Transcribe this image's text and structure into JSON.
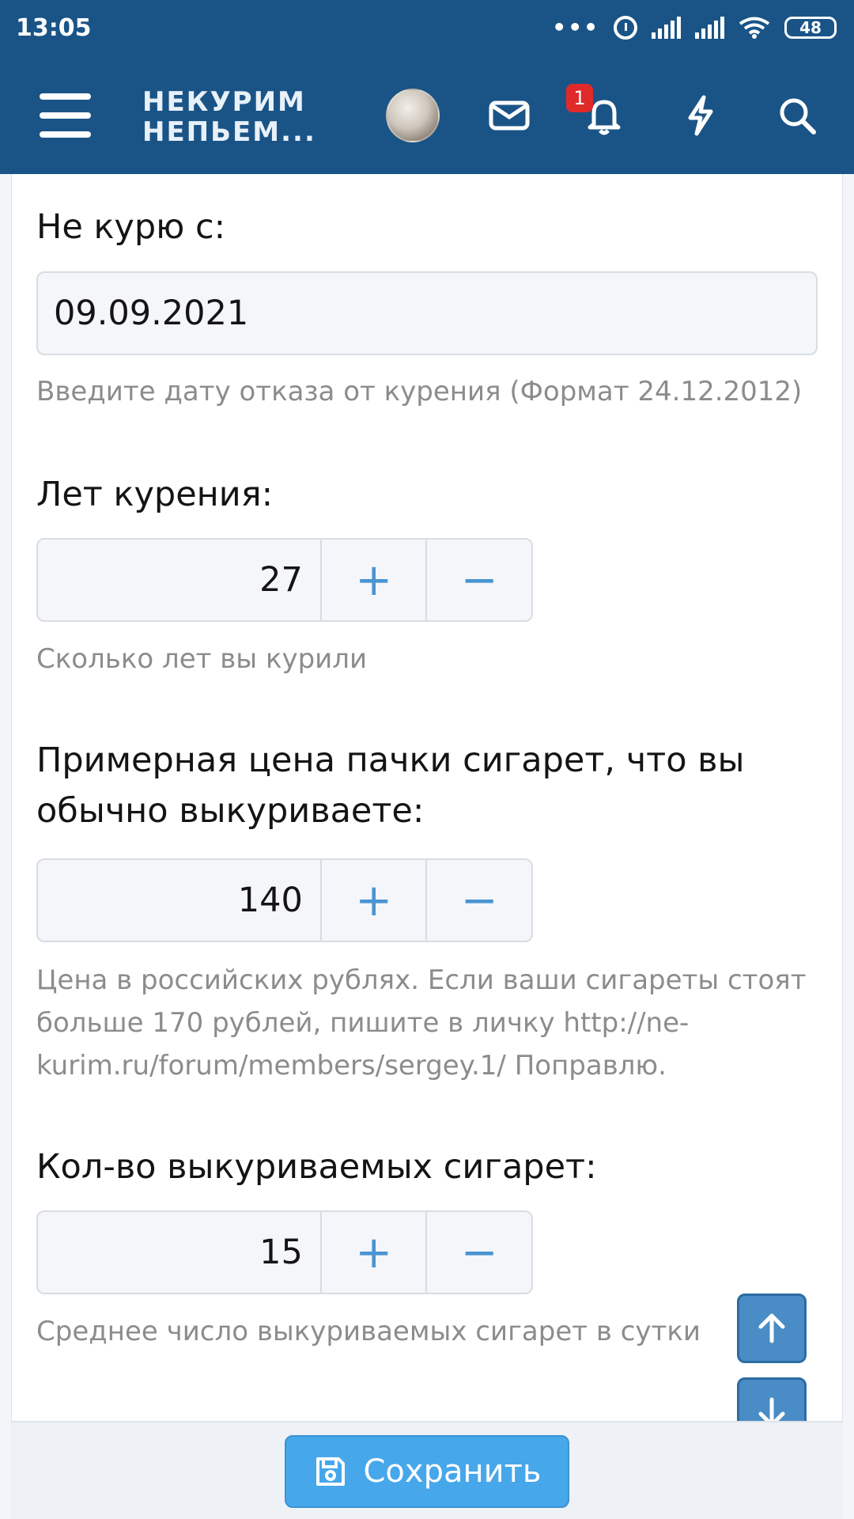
{
  "status_bar": {
    "time": "13:05",
    "battery": "48",
    "icons": [
      "more-dots-icon",
      "alarm-icon",
      "signal-icon",
      "signal-icon",
      "wifi-icon",
      "battery-icon"
    ]
  },
  "header": {
    "logo_line1": "НЕКУРИМ",
    "logo_line2": "НЕПЬЕМ...",
    "notification_count": "1",
    "icons": [
      "menu-icon",
      "avatar",
      "mail-icon",
      "bell-icon",
      "flash-icon",
      "search-icon"
    ],
    "background_color": "#1a5487"
  },
  "form": {
    "quit_date": {
      "label": "Не курю с:",
      "value": "09.09.2021",
      "hint": "Введите дату отказа от курения (Формат 24.12.2012)"
    },
    "years_smoking": {
      "label": "Лет курения:",
      "value": "27",
      "hint": "Сколько лет вы курили",
      "plus": "+",
      "minus": "−"
    },
    "pack_price": {
      "label_line1": "Примерная цена пачки сигарет, что вы",
      "label_line2": "обычно выкуриваете:",
      "value": "140",
      "hint_line1": "Цена в российских рублях. Если ваши сигареты стоят",
      "hint_line2": "больше 170 рублей, пишите в личку http://ne-",
      "hint_line3": "kurim.ru/forum/members/sergey.1/ Поправлю.",
      "plus": "+",
      "minus": "−"
    },
    "cigarettes_per_day": {
      "label": "Кол-во выкуриваемых сигарет:",
      "value": "15",
      "hint": "Среднее число выкуриваемых сигарет в сутки",
      "plus": "+",
      "minus": "−"
    }
  },
  "footer": {
    "save_label": "Сохранить",
    "accent_color": "#47a7eb"
  }
}
